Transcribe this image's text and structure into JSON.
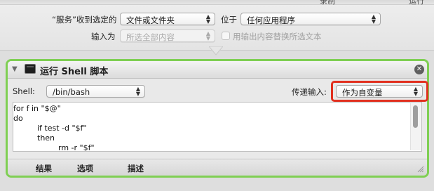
{
  "topbar": {
    "partial_a": "录制",
    "partial_b": "运行"
  },
  "service": {
    "receives_label": "“服务”收到选定的",
    "receives_value": "文件或文件夹",
    "in_label": "位于",
    "in_value": "任何应用程序",
    "input_is_label": "输入为",
    "input_is_value": "所选全部内容",
    "replace_checkbox_label": "用输出内容替换所选文本"
  },
  "action": {
    "title": "运行 Shell 脚本",
    "shell_label": "Shell:",
    "shell_value": "/bin/bash",
    "pass_input_label": "传递输入:",
    "pass_input_value": "作为自变量",
    "script_lines": [
      "for f in \"$@\"",
      "do",
      "if test -d \"$f\"",
      "then",
      "rm -r \"$f\""
    ],
    "tabs": [
      "结果",
      "选项",
      "描述"
    ]
  },
  "icons": {
    "disclosure": "disclosure-triangle-icon",
    "terminal": "terminal-icon",
    "close": "close-icon",
    "popup": "up-down-arrows-icon",
    "resize": "resize-grip-icon"
  },
  "colors": {
    "card_border": "#7fcf53",
    "highlight": "#e1301f",
    "close_button": "#5f5f5f"
  }
}
